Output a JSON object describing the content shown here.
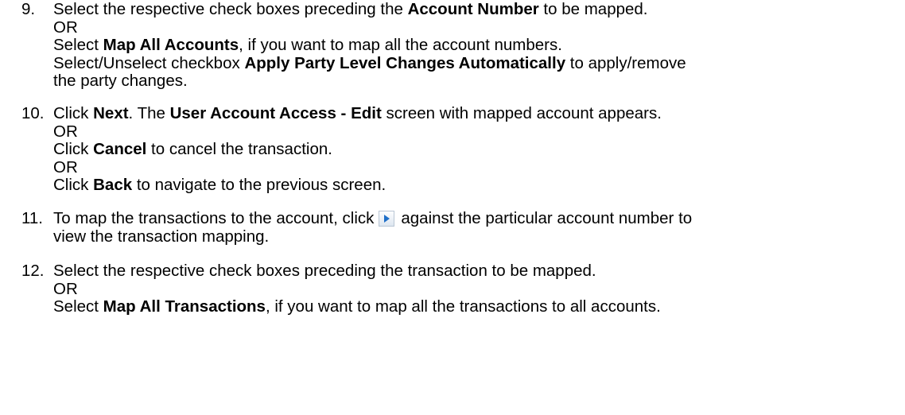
{
  "steps": [
    {
      "number": "9.",
      "lines": [
        {
          "a": "Select the respective check boxes preceding the ",
          "b": "Account Number",
          "c": " to be mapped."
        },
        {
          "a": "OR"
        },
        {
          "a": "Select ",
          "b": "Map All Accounts",
          "c": ", if you want to map all the account numbers."
        },
        {
          "a": "Select/Unselect checkbox ",
          "b": "Apply Party Level Changes Automatically",
          "c": " to apply/remove"
        },
        {
          "a": "the party changes."
        }
      ]
    },
    {
      "number": "10.",
      "lines": [
        {
          "a": "Click ",
          "b": "Next",
          "c": ". The ",
          "d": "User Account Access - Edit",
          "e": " screen with mapped account appears."
        },
        {
          "a": "OR"
        },
        {
          "a": "Click ",
          "b": "Cancel",
          "c": " to cancel the transaction."
        },
        {
          "a": "OR"
        },
        {
          "a": "Click ",
          "b": "Back",
          "c": " to navigate to the previous screen."
        }
      ]
    },
    {
      "number": "11.",
      "lines": [
        {
          "a": "To map the transactions to the account, click",
          "icon": "expand-arrow-icon",
          "c": "against the particular account number to"
        },
        {
          "a": "view the transaction mapping."
        }
      ]
    },
    {
      "number": "12.",
      "lines": [
        {
          "a": "Select the respective check boxes preceding the transaction to be mapped."
        },
        {
          "a": "OR"
        },
        {
          "a": "Select ",
          "b": "Map All Transactions",
          "c": ", if you want to map all the transactions to all accounts."
        }
      ]
    }
  ],
  "colors": {
    "text": "#000000",
    "icon_arrow": "#1e6fc8"
  }
}
